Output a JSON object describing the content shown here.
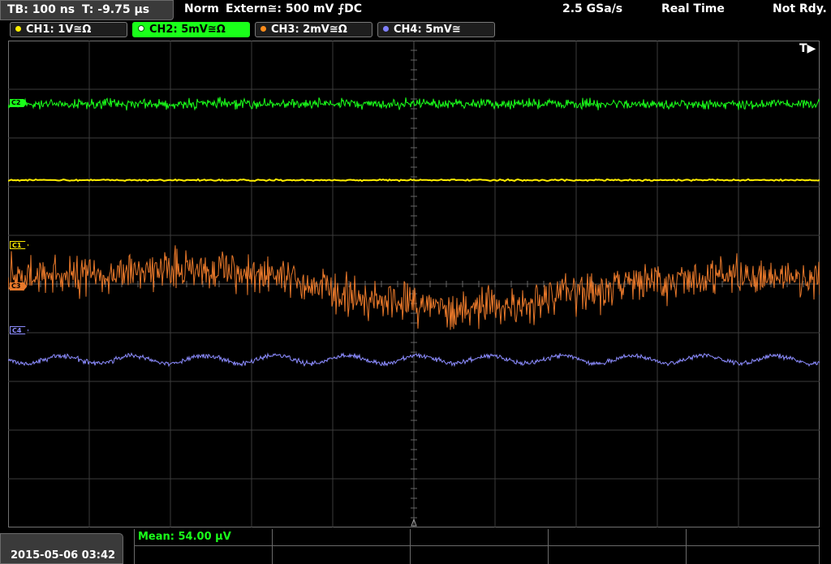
{
  "status": {
    "timebase": "TB: 100 ns",
    "trigger_time": "T: -9.75 µs",
    "mode": "Norm",
    "trigger_source": "Extern≅: 500 mV ⨍DC",
    "sample_rate": "2.5 GSa/s",
    "acq_mode": "Real Time",
    "state": "Not Rdy."
  },
  "channels": [
    {
      "label": "CH1: 1V≅Ω",
      "color": "#ffee00",
      "active": false
    },
    {
      "label": "CH2: 5mV≅Ω",
      "color": "#1aff1a",
      "active": true
    },
    {
      "label": "CH3: 2mV≅Ω",
      "color": "#ff8c1a",
      "active": false
    },
    {
      "label": "CH4: 5mV≅",
      "color": "#8080ff",
      "active": false
    }
  ],
  "markers": {
    "c1": "C1",
    "c2": "C2",
    "c3": "C3",
    "c4": "C4"
  },
  "trigger_marker": "T▶",
  "datetime": "2015-05-06 03:42",
  "measurement": "Mean: 54.00 µV",
  "colors": {
    "ch1": "#ffee00",
    "ch2": "#1aff1a",
    "ch3": "#e8782a",
    "ch4": "#8c8cff",
    "grid": "#3c3c3c"
  }
}
